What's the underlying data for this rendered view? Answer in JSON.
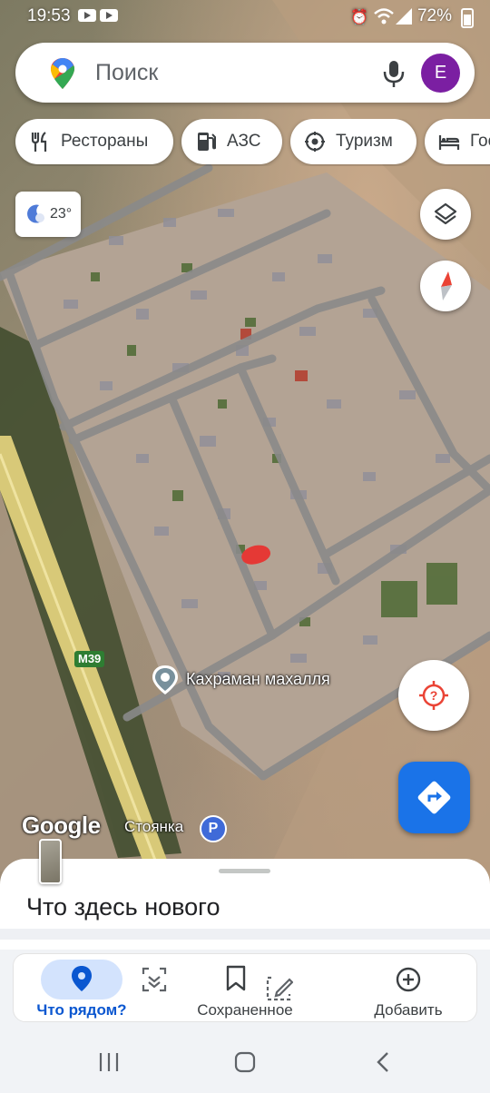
{
  "status_bar": {
    "time": "19:53",
    "battery": "72%"
  },
  "search": {
    "placeholder": "Поиск",
    "avatar_letter": "E"
  },
  "chips": [
    {
      "label": "Рестораны",
      "icon": "fork-knife-icon"
    },
    {
      "label": "АЗС",
      "icon": "gas-station-icon"
    },
    {
      "label": "Туризм",
      "icon": "camera-icon"
    },
    {
      "label": "Гос",
      "icon": "bed-icon"
    }
  ],
  "weather": {
    "temperature": "23°",
    "icon": "crescent-moon-icon"
  },
  "map": {
    "place_label": "Кахраман махалля",
    "road_shield": "M39",
    "attribution": "Google",
    "parking_label": "Стоянка",
    "parking_icon_letter": "P"
  },
  "sheet": {
    "title": "Что здесь нового"
  },
  "nav": {
    "explore": "Что рядом?",
    "saved": "Сохраненное",
    "contribute": "Добавить"
  },
  "colors": {
    "accent": "#1a73e8",
    "avatar": "#7b1fa2",
    "nav_active": "#0b57d0"
  }
}
